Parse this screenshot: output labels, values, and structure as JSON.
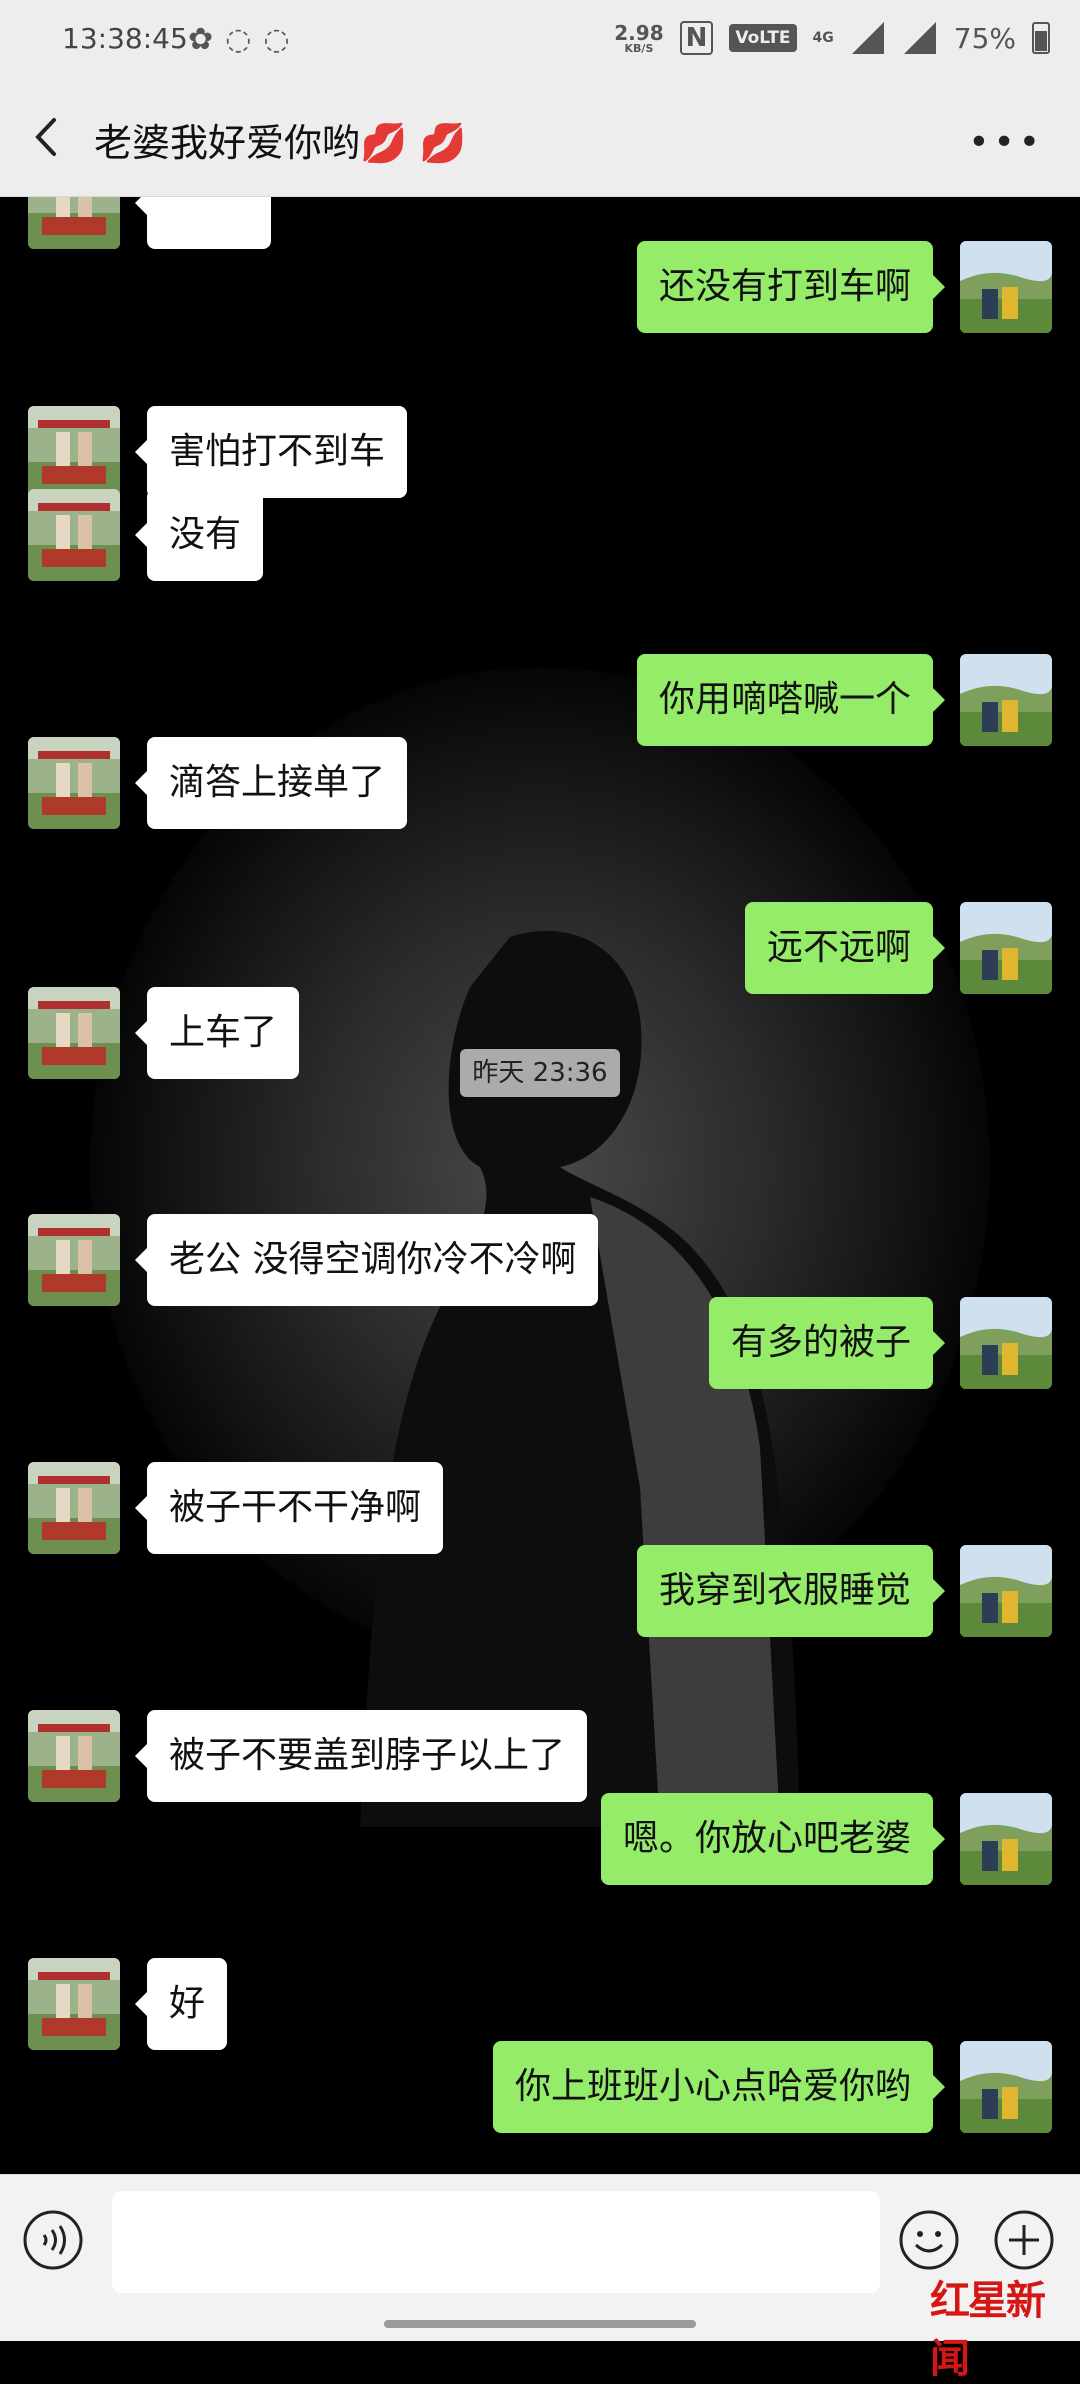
{
  "status": {
    "time": "13:38:45",
    "net_speed": "2.98",
    "net_unit": "KB/S",
    "nfc": "N",
    "volte": "VoLTE",
    "network": "4G",
    "battery": "75%",
    "battery_level": 0.75
  },
  "header": {
    "title": "老婆我好爱你哟💋 💋"
  },
  "messages": [
    {
      "side": "right",
      "text": "还没有打到车啊"
    },
    {
      "side": "left",
      "text": "害怕打不到车"
    },
    {
      "side": "left",
      "text": "没有"
    },
    {
      "side": "right",
      "text": "你用嘀嗒喊一个"
    },
    {
      "side": "left",
      "text": "滴答上接单了"
    },
    {
      "side": "right",
      "text": "远不远啊"
    },
    {
      "side": "left",
      "text": "上车了"
    },
    {
      "type": "timestamp",
      "text": "昨天 23:36"
    },
    {
      "side": "left",
      "text": "老公 没得空调你冷不冷啊"
    },
    {
      "side": "right",
      "text": "有多的被子"
    },
    {
      "side": "left",
      "text": "被子干不干净啊"
    },
    {
      "side": "right",
      "text": "我穿到衣服睡觉"
    },
    {
      "side": "left",
      "text": "被子不要盖到脖子以上了"
    },
    {
      "side": "right",
      "text": "嗯。你放心吧老婆"
    },
    {
      "side": "left",
      "text": "好"
    },
    {
      "side": "right",
      "text": "你上班班小心点哈爱你哟"
    }
  ],
  "input": {
    "placeholder": ""
  },
  "watermark": "红星新闻",
  "colors": {
    "sent_bubble": "#95ec69",
    "received_bubble": "#ffffff",
    "bar_bg": "#ededed"
  }
}
